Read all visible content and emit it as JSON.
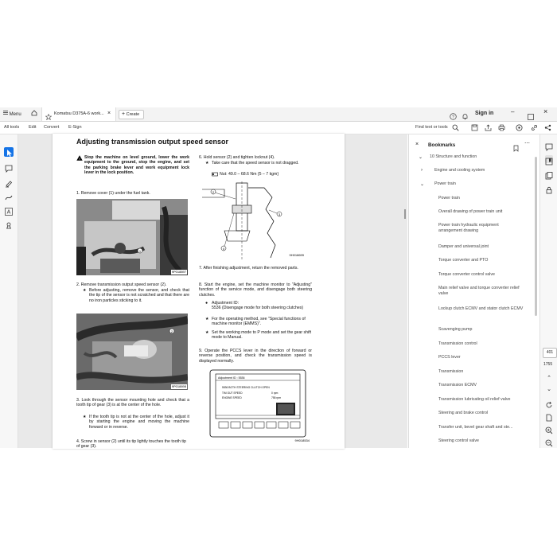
{
  "tabbar": {
    "menu_label": "Menu",
    "tab_title": "Komatsu D375A-6 work...",
    "create_label": "Create",
    "sign_in_label": "Sign in"
  },
  "toolbar": {
    "all_tools": "All tools",
    "edit": "Edit",
    "convert": "Convert",
    "esign": "E-Sign",
    "find": "Find text or tools"
  },
  "document": {
    "title": "Adjusting transmission output speed sensor",
    "warning": "Stop the machine on level ground, lower the work equipment to the ground, stop the engine, and set the parking brake lever and work equipment lock lever in the lock position.",
    "step1": "1.  Remove cover (1) under the fuel tank.",
    "photo1_label": "9P018897",
    "step2": "2.  Remove transmission output speed sensor (2).",
    "step2_note": "Before adjusting, remove the sensor, and check that the tip of the sensor is not scratched and that there are no iron particles sticking to it.",
    "photo2_label": "9P018898",
    "step3": "3.  Look through the sensor mounting hole and check that a tooth tip of gear (3) is at the center of the hole.",
    "step3_note": "If the tooth tip is not at the center of the hole, adjust it by starting the engine and moving the machine forward or in reverse.",
    "step4": "4.  Screw in sensor (2) until its tip lightly touches the tooth tip of gear (3).",
    "step6": "6.  Hold sensor (2) and tighten locknut (4).",
    "step6_note": "Take care that the speed sensor is not dragged.",
    "step6_torque": "Nut: 49.0 – 68.6 Nm {5 – 7 kgm}",
    "fig1_label": "9H018699",
    "step7": "7.  After finishing adjustment, return the removed parts.",
    "step8": "8.  Start the engine, set the machine monitor to \"Adjusting\" function of the service mode, and disengage both steering clutches.",
    "step8_b1": "Adjustment ID:",
    "step8_b1b": "5536 (Disengage mode for both steering clutches)",
    "step8_b2": "For the operating method, see \"Special functions of machine monitor (EMMS)\".",
    "step8_b3": "Set the working mode to P mode and set the gear shift mode to Manual.",
    "step9": "9.  Operate the PCCS lever in the direction of forward or reverse position, and check the transmission speed is displayed normally.",
    "monitor_header": "Adjustment     ID : 5536",
    "monitor_line1": "5536 BOTH STEERING CLUTCH OPEN",
    "monitor_line2a": "T/M OUT SPEED",
    "monitor_line2b": "0 rpm",
    "monitor_line3a": "ENGINE SPEED",
    "monitor_line3b": "755 rpm",
    "fig2_label": "9H018534",
    "fig1_callouts": [
      "2",
      "3",
      "4"
    ],
    "photo_callouts": [
      "1",
      "2"
    ]
  },
  "bookmarks": {
    "title": "Bookmarks",
    "items": [
      "10 Structure and function",
      "Engine and cooling system",
      "Power train",
      "Power train",
      "Overall drawing of power train unit",
      "Power train hydraulic equipment arrangement drawing",
      "Damper and universal joint",
      "Torque converter and PTO",
      "Torque converter control valve",
      "Main relief valve and torque converter relief valve",
      "Lockup clutch ECMV and stator clutch ECMV",
      "Scavenging pump",
      "Transmission control",
      "PCCS lever",
      "Transmission",
      "Transmission ECMV",
      "Transmission lubricating oil relief valve",
      "Steering and brake control",
      "Transfer unit, bevel gear shaft and ste...",
      "Steering control valve"
    ]
  },
  "rightrail": {
    "current_page": "401",
    "total_pages": "1755"
  },
  "colors": {
    "accent": "#1473e6",
    "warning_black": "#000000"
  }
}
